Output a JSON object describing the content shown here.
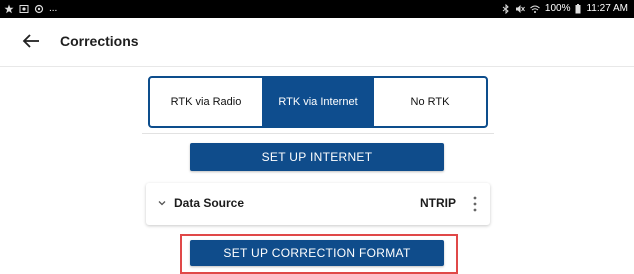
{
  "status_bar": {
    "left_icons": [
      "star-icon",
      "photo-icon",
      "settings-icon"
    ],
    "overflow": "...",
    "right_text": "100%",
    "time": "11:27 AM"
  },
  "app_bar": {
    "title": "Corrections"
  },
  "rtk_modes": {
    "options": [
      "RTK via Radio",
      "RTK via Internet",
      "No RTK"
    ],
    "selected": "RTK via Internet"
  },
  "setup_internet_button": "SET UP INTERNET",
  "data_source": {
    "label": "Data Source",
    "value": "NTRIP"
  },
  "setup_correction_format_button": "SET UP CORRECTION FORMAT",
  "colors": {
    "accent": "#0e4d8e",
    "highlight": "#e04848"
  }
}
